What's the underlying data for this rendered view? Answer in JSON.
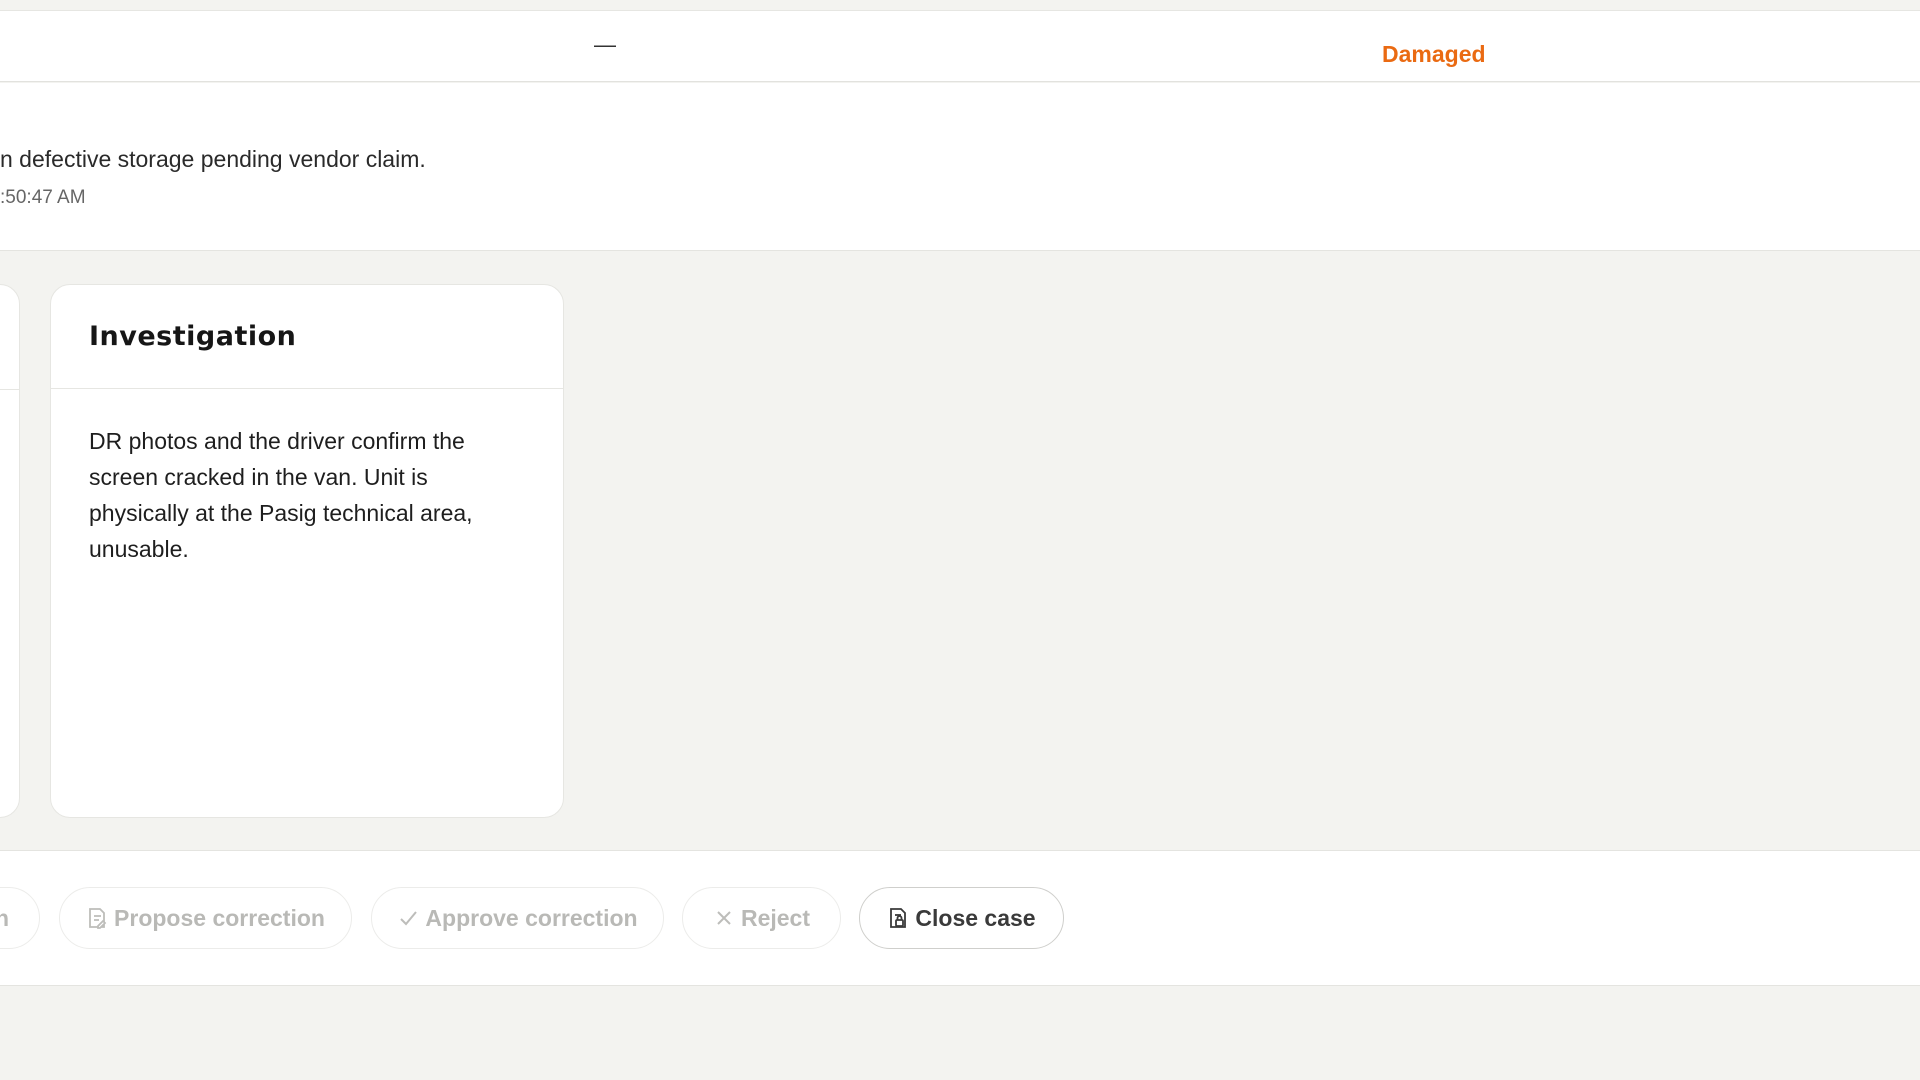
{
  "row": {
    "dash": "—",
    "status": "Damaged",
    "status_color": "#ea6a12"
  },
  "note": {
    "text": "n defective storage pending vendor claim.",
    "time": ":50:47 AM"
  },
  "partial_button_label": "n",
  "card": {
    "title": "Investigation",
    "body": "DR photos and the driver confirm the screen cracked in the van. Unit is physically at the Pasig technical area, unusable."
  },
  "actions": {
    "propose": {
      "label": "Propose correction",
      "icon": "document-edit-icon"
    },
    "approve": {
      "label": "Approve correction",
      "icon": "check-icon"
    },
    "reject": {
      "label": "Reject",
      "icon": "x-icon"
    },
    "close": {
      "label": "Close case",
      "icon": "document-lock-icon"
    }
  }
}
